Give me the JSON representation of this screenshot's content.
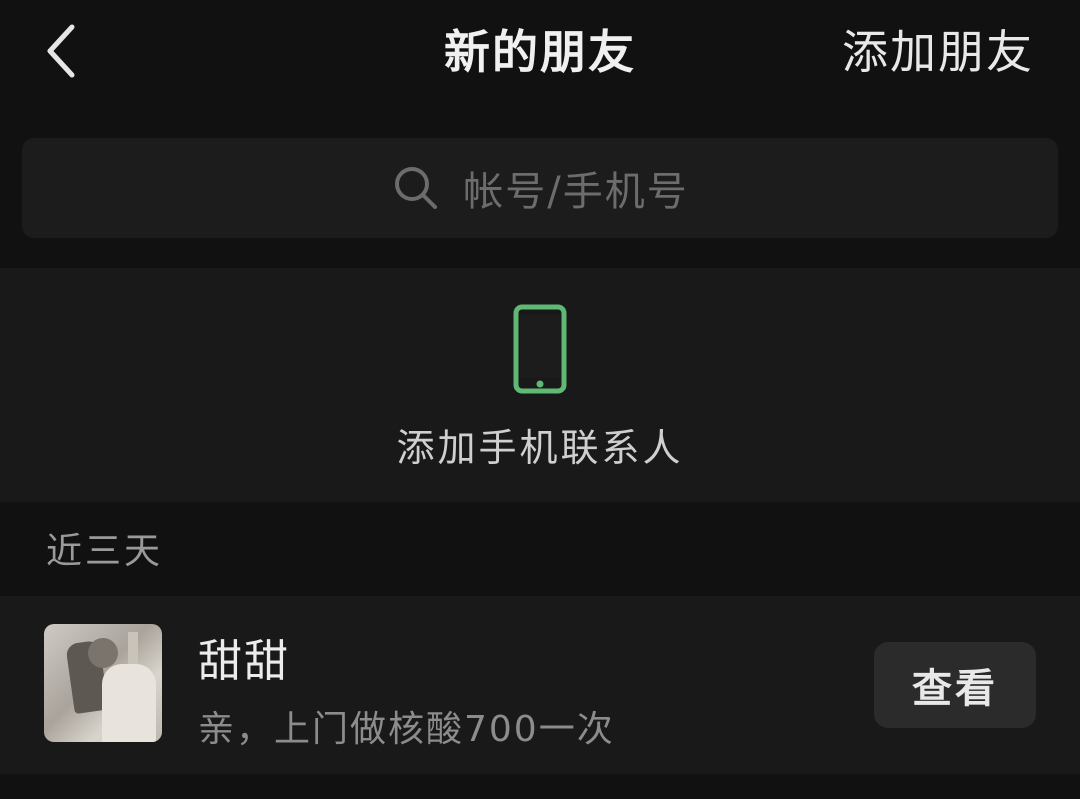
{
  "header": {
    "back_icon": "chevron-left-icon",
    "title": "新的朋友",
    "action_label": "添加朋友"
  },
  "search": {
    "icon": "search-icon",
    "placeholder": "帐号/手机号"
  },
  "phone_contacts": {
    "icon": "mobile-phone-icon",
    "label": "添加手机联系人",
    "icon_color": "#5fb874"
  },
  "recent_section": {
    "title": "近三天",
    "items": [
      {
        "name": "甜甜",
        "message": "亲，上门做核酸700一次",
        "button_label": "查看"
      }
    ]
  },
  "colors": {
    "background": "#111111",
    "panel": "#191919",
    "search_box": "#1c1c1c",
    "button": "#2b2b2b",
    "accent_green": "#5fb874"
  }
}
